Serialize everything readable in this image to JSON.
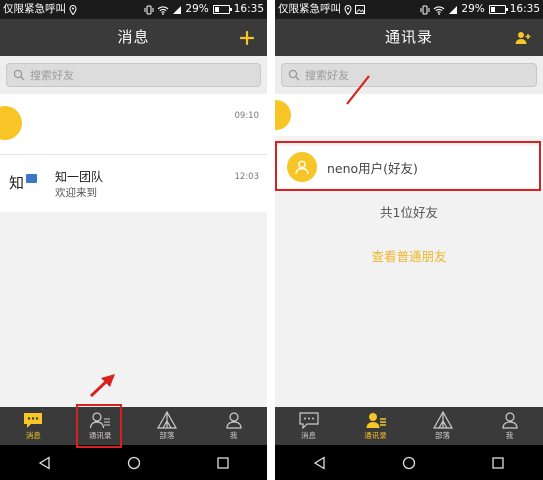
{
  "colors": {
    "accent": "#f7c626",
    "bar": "#3a3a3a",
    "highlight": "#d42320",
    "link": "#f0b62a"
  },
  "status_bar": {
    "carrier": "仅限紧急呼叫",
    "battery": "29%",
    "battery_level": 0.29,
    "time": "16:35",
    "icons": [
      "location-icon",
      "vibrate-icon",
      "wifi-icon",
      "signal-icon"
    ]
  },
  "left_screen": {
    "title": "消息",
    "search_placeholder": "搜索好友",
    "messages": [
      {
        "name": "",
        "snippet": "",
        "time": "09:10",
        "avatar": "user-avatar"
      },
      {
        "name": "知一团队",
        "snippet": "欢迎来到",
        "time": "12:03",
        "logo_text": "知"
      }
    ],
    "tabs": [
      {
        "label": "消息",
        "icon": "chat-icon",
        "active": true
      },
      {
        "label": "通讯录",
        "icon": "contacts-icon",
        "active": false
      },
      {
        "label": "部落",
        "icon": "tent-icon",
        "active": false
      },
      {
        "label": "我",
        "icon": "person-icon",
        "active": false
      }
    ]
  },
  "right_screen": {
    "title": "通讯录",
    "search_placeholder": "搜索好友",
    "friends": [
      {
        "name": ""
      },
      {
        "name": "neno用户(好友)"
      }
    ],
    "friend_count": "共1位好友",
    "view_link": "查看普通朋友",
    "tabs": [
      {
        "label": "消息",
        "icon": "chat-icon",
        "active": false
      },
      {
        "label": "通讯录",
        "icon": "contacts-icon",
        "active": true
      },
      {
        "label": "部落",
        "icon": "tent-icon",
        "active": false
      },
      {
        "label": "我",
        "icon": "person-icon",
        "active": false
      }
    ]
  }
}
